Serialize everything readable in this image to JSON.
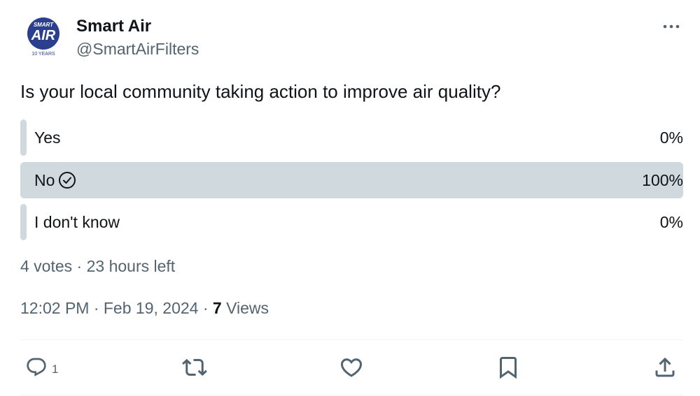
{
  "author": {
    "name": "Smart Air",
    "handle": "@SmartAirFilters",
    "avatar_text_top": "SMART",
    "avatar_text_main": "AIR",
    "avatar_text_bottom": "10 YEARS",
    "avatar_color": "#2b3f8f"
  },
  "tweet": {
    "question": "Is your local community taking action to improve air quality?"
  },
  "poll": {
    "options": [
      {
        "label": "Yes",
        "percent_text": "0%",
        "percent": 0,
        "selected": false
      },
      {
        "label": "No",
        "percent_text": "100%",
        "percent": 100,
        "selected": true
      },
      {
        "label": "I don't know",
        "percent_text": "0%",
        "percent": 0,
        "selected": false
      }
    ],
    "fill_color": "#cfd9de",
    "meta": "4 votes · 23 hours left"
  },
  "footer": {
    "timestamp": "12:02 PM · Feb 19, 2024 · ",
    "views_count": "7",
    "views_label": " Views"
  },
  "actions": {
    "reply_count": "1",
    "icons": [
      "reply-icon",
      "retweet-icon",
      "like-icon",
      "bookmark-icon",
      "share-icon"
    ]
  },
  "colors": {
    "text_primary": "#0f1419",
    "text_secondary": "#536471"
  }
}
